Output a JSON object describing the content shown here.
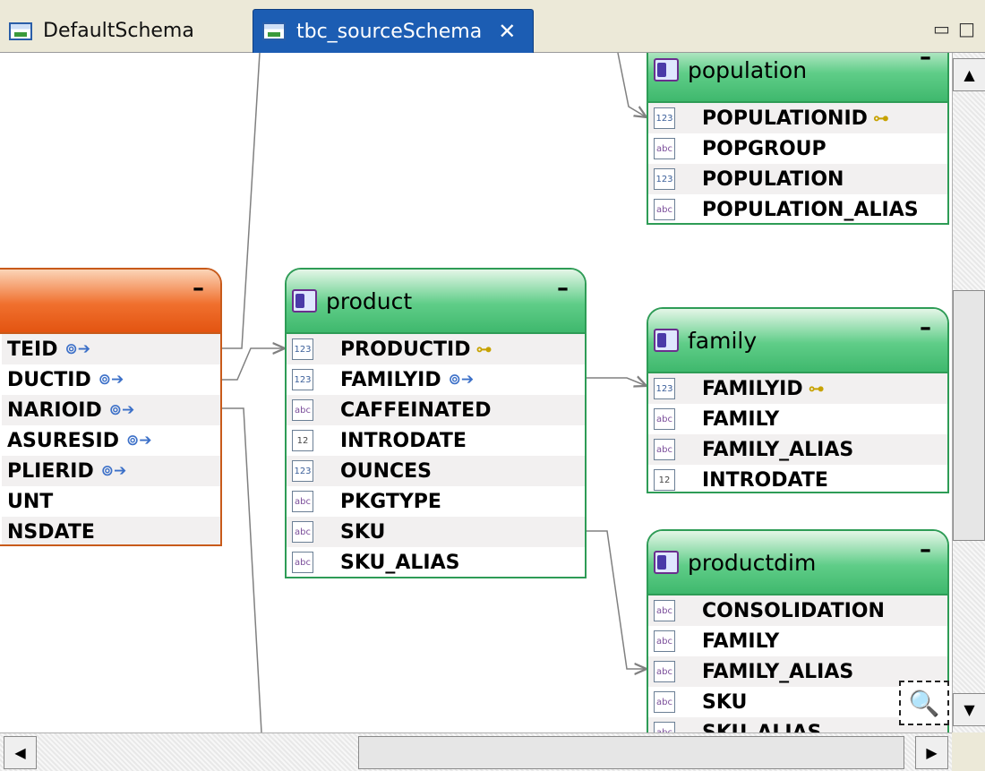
{
  "tabs": [
    {
      "label": "DefaultSchema",
      "active": false
    },
    {
      "label": "tbc_sourceSchema",
      "active": true,
      "close": "✕"
    }
  ],
  "window": {
    "minimize": "▭",
    "maximize": "□"
  },
  "tables": {
    "fact": {
      "title": "",
      "rows": [
        {
          "name": "TEID",
          "marker": "fk"
        },
        {
          "name": "DUCTID",
          "marker": "fk"
        },
        {
          "name": "NARIOID",
          "marker": "fk"
        },
        {
          "name": "ASURESID",
          "marker": "fk"
        },
        {
          "name": "PLIERID",
          "marker": "fk"
        },
        {
          "name": "UNT",
          "marker": ""
        },
        {
          "name": "NSDATE",
          "marker": ""
        }
      ]
    },
    "product": {
      "title": "product",
      "rows": [
        {
          "name": "PRODUCTID",
          "type": "123",
          "marker": "key"
        },
        {
          "name": "FAMILYID",
          "type": "123",
          "marker": "fk"
        },
        {
          "name": "CAFFEINATED",
          "type": "abc",
          "marker": ""
        },
        {
          "name": "INTRODATE",
          "type": "12",
          "marker": ""
        },
        {
          "name": "OUNCES",
          "type": "123",
          "marker": ""
        },
        {
          "name": "PKGTYPE",
          "type": "abc",
          "marker": ""
        },
        {
          "name": "SKU",
          "type": "abc",
          "marker": ""
        },
        {
          "name": "SKU_ALIAS",
          "type": "abc",
          "marker": ""
        }
      ]
    },
    "population": {
      "title": "population",
      "rows": [
        {
          "name": "POPULATIONID",
          "type": "123",
          "marker": "key"
        },
        {
          "name": "POPGROUP",
          "type": "abc",
          "marker": ""
        },
        {
          "name": "POPULATION",
          "type": "123",
          "marker": ""
        },
        {
          "name": "POPULATION_ALIAS",
          "type": "abc",
          "marker": ""
        }
      ]
    },
    "family": {
      "title": "family",
      "rows": [
        {
          "name": "FAMILYID",
          "type": "123",
          "marker": "key"
        },
        {
          "name": "FAMILY",
          "type": "abc",
          "marker": ""
        },
        {
          "name": "FAMILY_ALIAS",
          "type": "abc",
          "marker": ""
        },
        {
          "name": "INTRODATE",
          "type": "12",
          "marker": ""
        }
      ]
    },
    "productdim": {
      "title": "productdim",
      "rows": [
        {
          "name": "CONSOLIDATION",
          "type": "abc",
          "marker": ""
        },
        {
          "name": "FAMILY",
          "type": "abc",
          "marker": ""
        },
        {
          "name": "FAMILY_ALIAS",
          "type": "abc",
          "marker": ""
        },
        {
          "name": "SKU",
          "type": "abc",
          "marker": ""
        },
        {
          "name": "SKU_ALIAS",
          "type": "abc",
          "marker": ""
        }
      ]
    }
  },
  "icons": {
    "key": "⊶",
    "fk": "⊚➔",
    "collapse": "–",
    "zoom": "🔍",
    "scroll_up": "▲",
    "scroll_down": "▼",
    "scroll_left": "◀",
    "scroll_right": "▶"
  },
  "colors": {
    "tab_active": "#1c5db3",
    "table_green": "#3fb86d",
    "table_red": "#e35411",
    "link_line": "#808080"
  }
}
